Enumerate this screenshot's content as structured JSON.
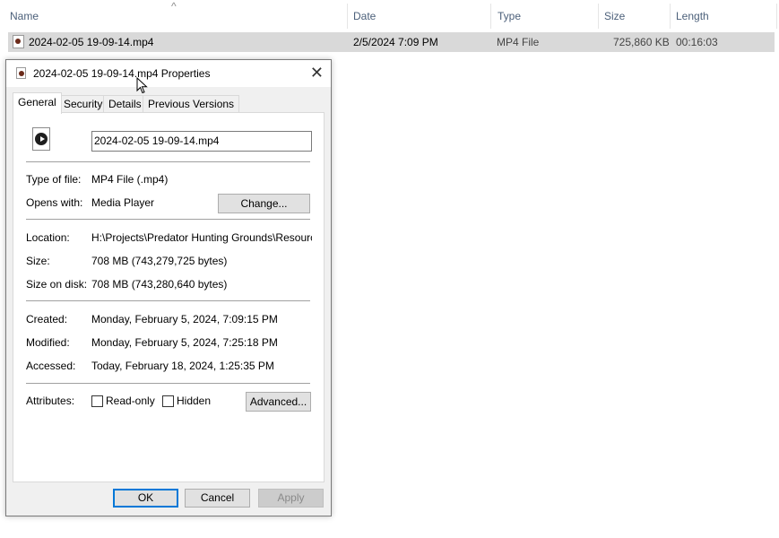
{
  "explorer": {
    "columns": [
      "Name",
      "Date",
      "Type",
      "Size",
      "Length"
    ],
    "file_row": {
      "name": "2024-02-05 19-09-14.mp4",
      "date": "2/5/2024 7:09 PM",
      "type": "MP4 File",
      "size": "725,860 KB",
      "length": "00:16:03"
    },
    "sort_indicator": "^"
  },
  "dialog": {
    "title": "2024-02-05 19-09-14.mp4 Properties",
    "close_glyph": "✕",
    "tabs": [
      "General",
      "Security",
      "Details",
      "Previous Versions"
    ],
    "filename_value": "2024-02-05 19-09-14.mp4",
    "type_label": "Type of file:",
    "type_value": "MP4 File (.mp4)",
    "opens_label": "Opens with:",
    "opens_value": "Media Player",
    "change_button": "Change...",
    "location_label": "Location:",
    "location_value": "H:\\Projects\\Predator Hunting Grounds\\Resource - E",
    "size_label": "Size:",
    "size_value": "708 MB (743,279,725 bytes)",
    "sizeondisk_label": "Size on disk:",
    "sizeondisk_value": "708 MB (743,280,640 bytes)",
    "created_label": "Created:",
    "created_value": "Monday, February 5, 2024, 7:09:15 PM",
    "modified_label": "Modified:",
    "modified_value": "Monday, February 5, 2024, 7:25:18 PM",
    "accessed_label": "Accessed:",
    "accessed_value": "Today, February 18, 2024, 1:25:35 PM",
    "attributes_label": "Attributes:",
    "readonly_label": "Read-only",
    "hidden_label": "Hidden",
    "advanced_button": "Advanced...",
    "ok_button": "OK",
    "cancel_button": "Cancel",
    "apply_button": "Apply"
  },
  "colors": {
    "header_text": "#4c607a",
    "selected_row": "#d9d9d9",
    "ok_border": "#0078d7"
  }
}
